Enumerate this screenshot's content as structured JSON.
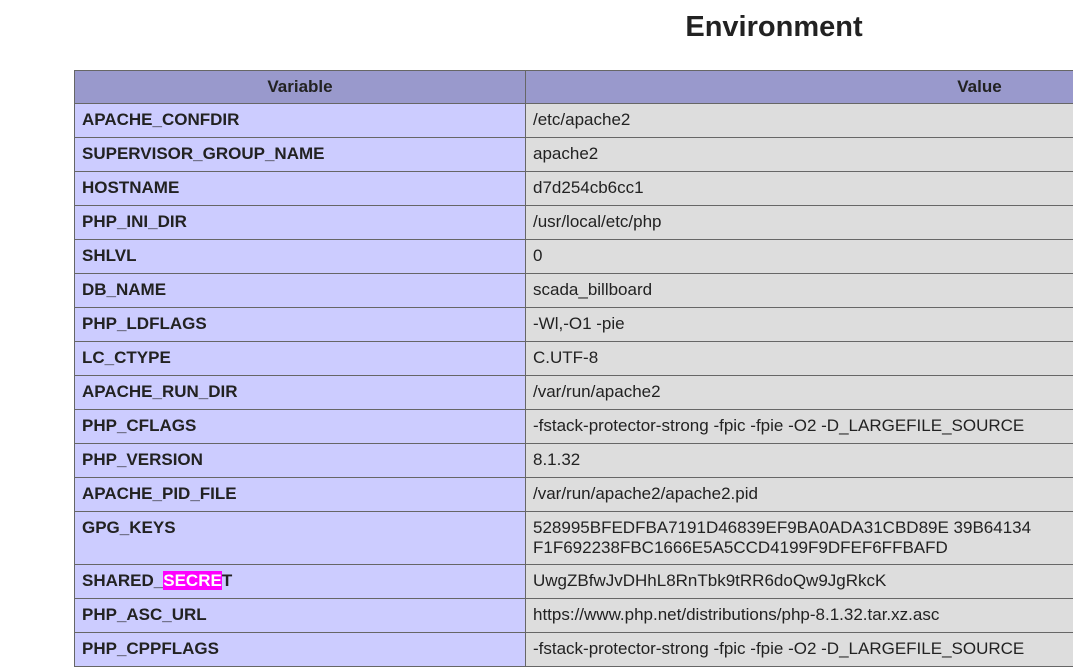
{
  "heading": "Environment",
  "table": {
    "headers": {
      "variable": "Variable",
      "value": "Value"
    },
    "rows": [
      {
        "name": "APACHE_CONFDIR",
        "value": "/etc/apache2"
      },
      {
        "name": "SUPERVISOR_GROUP_NAME",
        "value": "apache2"
      },
      {
        "name": "HOSTNAME",
        "value": "d7d254cb6cc1"
      },
      {
        "name": "PHP_INI_DIR",
        "value": "/usr/local/etc/php"
      },
      {
        "name": "SHLVL",
        "value": "0"
      },
      {
        "name": "DB_NAME",
        "value": "scada_billboard"
      },
      {
        "name": "PHP_LDFLAGS",
        "value": "-Wl,-O1 -pie"
      },
      {
        "name": "LC_CTYPE",
        "value": "C.UTF-8"
      },
      {
        "name": "APACHE_RUN_DIR",
        "value": "/var/run/apache2"
      },
      {
        "name": "PHP_CFLAGS",
        "value": "-fstack-protector-strong -fpic -fpie -O2 -D_LARGEFILE_SOURCE"
      },
      {
        "name": "PHP_VERSION",
        "value": "8.1.32"
      },
      {
        "name": "APACHE_PID_FILE",
        "value": "/var/run/apache2/apache2.pid"
      },
      {
        "name": "GPG_KEYS",
        "value_line1": "528995BFEDFBA7191D46839EF9BA0ADA31CBD89E 39B64134",
        "value_line2": "F1F692238FBC1666E5A5CCD4199F9DFEF6FFBAFD"
      },
      {
        "name_prefix": "SHARED_",
        "name_highlight": "SECRE",
        "name_suffix": "T",
        "value": "UwgZBfwJvDHhL8RnTbk9tRR6doQw9JgRkcK"
      },
      {
        "name": "PHP_ASC_URL",
        "value": "https://www.php.net/distributions/php-8.1.32.tar.xz.asc"
      },
      {
        "name": "PHP_CPPFLAGS",
        "value": "-fstack-protector-strong -fpic -fpie -O2 -D_LARGEFILE_SOURCE"
      }
    ]
  },
  "colors": {
    "header_bg": "#9999cc",
    "var_bg": "#ccccff",
    "value_bg": "#dddddd",
    "highlight": "#ff00ff"
  }
}
